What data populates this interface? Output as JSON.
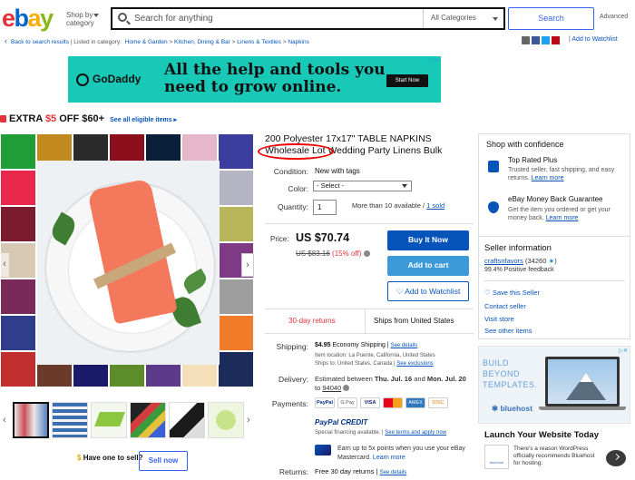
{
  "header": {
    "logo": {
      "e1": "e",
      "b": "b",
      "a": "a",
      "y": "y"
    },
    "shop_by_line1": "Shop by",
    "shop_by_line2": "category",
    "search_placeholder": "Search for anything",
    "category_select": "All Categories",
    "search_button": "Search",
    "advanced": "Advanced"
  },
  "breadcrumb": {
    "back": "Back to search results",
    "listed_in": "Listed in category:",
    "items": [
      "Home & Garden",
      "Kitchen, Dining & Bar",
      "Linens & Textiles",
      "Napkins"
    ],
    "sep": ">",
    "add_to_watchlist": "Add to Watchlist"
  },
  "ad_banner": {
    "brand": "GoDaddy",
    "headline_line1": "All the help and tools you",
    "headline_line2": "need to grow online.",
    "cta": "Start Now",
    "ad_choices": "▷✕"
  },
  "promo": {
    "prefix": "EXTRA ",
    "amount": "$5",
    "suffix": " OFF $60+",
    "link": "See all eligible items ▸"
  },
  "gallery": {
    "swatch_colors": [
      "#1f9e37",
      "#c28a1e",
      "#2a2a2a",
      "#8b0e1a",
      "#0a1f3a",
      "#e6b6c9",
      "#3b3e9c",
      "#e8274a",
      "#f0c0c8",
      "#e6dbe8",
      "#f3e9d5",
      "#e9eaeb",
      "#6a7f9a",
      "#b5b5c3",
      "#7c1a2e",
      "#c4384b",
      "#d8b83a",
      "#c77b2a",
      "#5a8d2c",
      "#1f6b48",
      "#b8b55a",
      "#d7c9b3",
      "#a7d27a",
      "#4d4d4d",
      "#9a2a2a",
      "#8aa030",
      "#3d6b2c",
      "#7f3a86",
      "#7a2a5a",
      "#e6cd4a",
      "#d6b8e6",
      "#3a8fd6",
      "#1ab6b0",
      "#e0e0e0",
      "#9e9e9e",
      "#2f3d8a",
      "#cc7a2e",
      "#e58b2e",
      "#4ea5d6",
      "#c94f8f",
      "#e6c13a",
      "#f07c2a",
      "#c22f2f",
      "#6b3a2a",
      "#1a1a6a",
      "#5c8d2a",
      "#5e3a8a",
      "#f3e0b8",
      "#1b2c5a",
      "#b1171f",
      "#d9c8a1",
      "#e3a63b",
      "#c8aa7a"
    ],
    "thumb_nav_left": "‹",
    "thumb_nav_right": "›",
    "main_nav_right": "›",
    "main_nav_left": "‹"
  },
  "sell": {
    "icon": "$",
    "have_one": "Have one to sell?",
    "sell_now": "Sell now"
  },
  "item": {
    "title": "200 Polyester 17x17\" TABLE NAPKINS Wholesale Lot Wedding Party Linens Bulk",
    "condition_label": "Condition:",
    "condition_value": "New with tags",
    "color_label": "Color:",
    "color_value": "- Select -",
    "quantity_label": "Quantity:",
    "quantity_value": "1",
    "available": "More than 10 available /",
    "sold": "1 sold",
    "price_label": "Price:",
    "price": "US $70.74",
    "was_price": "US $83.16",
    "discount": "(15% off)",
    "buy_now": "Buy It Now",
    "add_to_cart": "Add to cart",
    "add_to_watchlist": "Add to Watchlist",
    "returns_badge": "30-day returns",
    "ships_from": "Ships from United States",
    "shipping_label": "Shipping:",
    "shipping_price": "$4.95",
    "shipping_method": "Economy Shipping |",
    "see_details": "See details",
    "item_location": "Item location:  La Puente, California, United States",
    "ships_to_prefix": "Ships to:  United States, Canada |",
    "see_exclusions": "See exclusions",
    "delivery_label": "Delivery:",
    "delivery_text": "Estimated between",
    "delivery_date1": "Thu. Jul. 16",
    "delivery_and": "and",
    "delivery_date2": "Mon. Jul. 20",
    "delivery_to": "to",
    "delivery_zip": "94040",
    "payments_label": "Payments:",
    "pay_methods": [
      "PayPal",
      "G Pay",
      "VISA",
      "MC",
      "AMEX",
      "DISC"
    ],
    "paypal_credit": "PayPal CREDIT",
    "special_financing": "Special financing available. |",
    "see_terms": "See terms and apply now",
    "earn_points": "Earn up to 5x points when you use your eBay Mastercard.",
    "learn_more": "Learn more",
    "returns_label": "Returns:",
    "returns_value": "Free 30 day returns |",
    "returns_see_details": "See details"
  },
  "confidence": {
    "title": "Shop with confidence",
    "top_rated_title": "Top Rated Plus",
    "top_rated_desc": "Trusted seller, fast shipping, and easy returns.",
    "top_rated_learn": "Learn more",
    "mbg_title": "eBay Money Back Guarantee",
    "mbg_desc": "Get the item you ordered or get your money back.",
    "mbg_learn": "Learn more"
  },
  "seller": {
    "title": "Seller information",
    "name": "craftsnfavors",
    "feedback": "(34260",
    "star": "★",
    "positive": "99.4% Positive feedback",
    "save": "Save this Seller",
    "contact": "Contact seller",
    "visit": "Visit store",
    "other": "See other items"
  },
  "side_ad": {
    "line1": "BUILD",
    "line2": "BEYOND",
    "line3": "TEMPLATES.",
    "brand": "✱ bluehost",
    "title": "Launch Your Website Today",
    "thumb_brand": "bluehost",
    "desc": "There's a reason WordPress officially recommends Bluehost for hosting.",
    "ad_choices": "▷✕"
  }
}
